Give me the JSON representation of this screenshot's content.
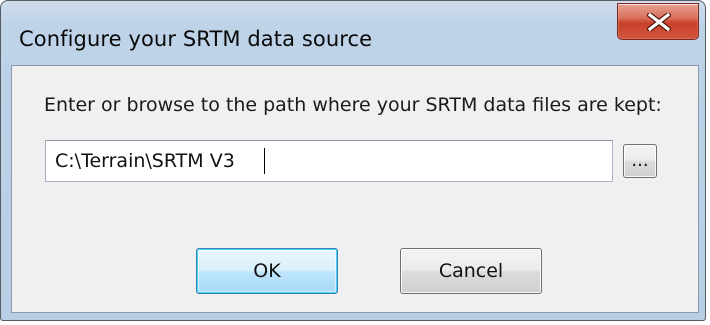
{
  "window": {
    "title": "Configure your SRTM data source",
    "close_icon": "close-x-icon"
  },
  "form": {
    "prompt": "Enter or browse to the path where your SRTM data files are kept:",
    "path_value": "C:\\Terrain\\SRTM V3",
    "browse_label": "..."
  },
  "buttons": {
    "ok_label": "OK",
    "cancel_label": "Cancel"
  },
  "colors": {
    "title_bar": "#bed2e8",
    "client_bg": "#f0f0f0",
    "close_button": "#c8412a",
    "default_button_border": "#3c7fb1"
  }
}
